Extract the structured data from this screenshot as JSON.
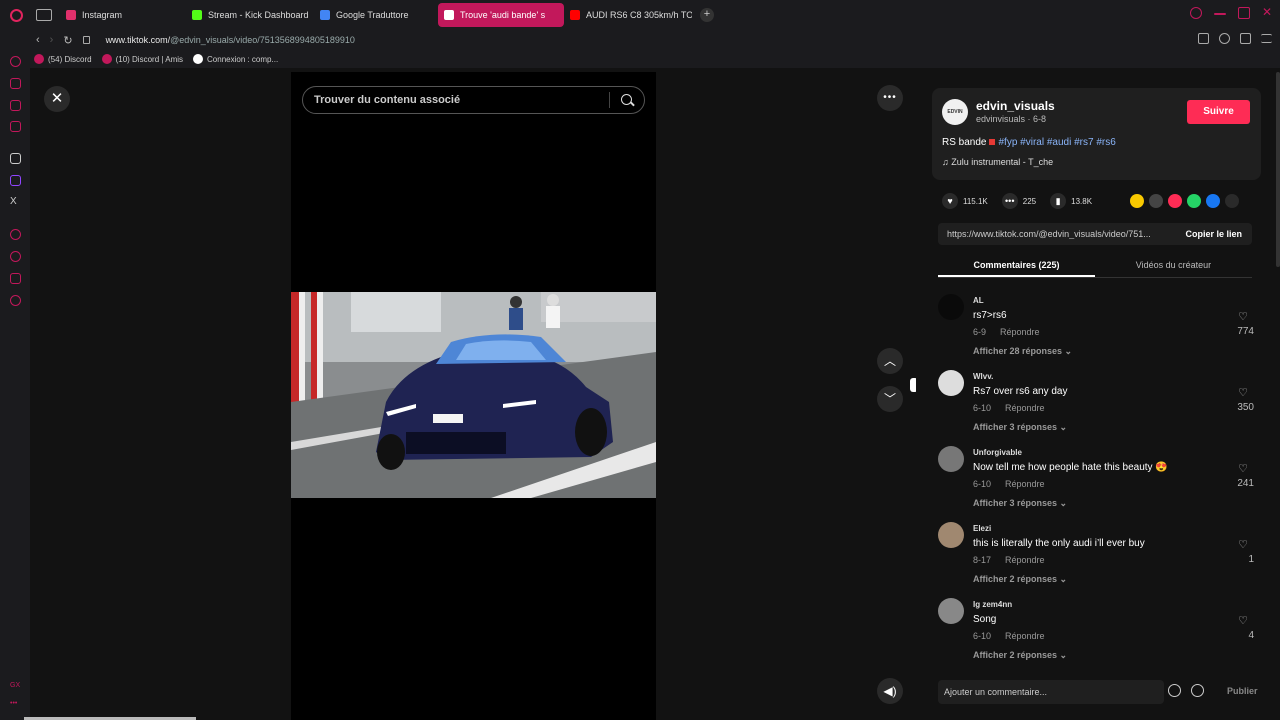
{
  "tabs": [
    {
      "label": "Instagram",
      "color": "#e1306c"
    },
    {
      "label": "Stream - Kick Dashboard",
      "color": "#53fc18"
    },
    {
      "label": "Google Traduttore",
      "color": "#4285f4"
    },
    {
      "label": "Trouve 'audi bande' s",
      "color": "#ffffff",
      "active": true
    },
    {
      "label": "AUDI RS6 C8 305km/h TO",
      "color": "#ff0000"
    }
  ],
  "address": {
    "prefix": "www.tiktok.com/",
    "path": "@edvin_visuals/video/7513568994805189910"
  },
  "bookmarks": [
    {
      "label": "(54) Discord",
      "color": "#c2185b"
    },
    {
      "label": "(10) Discord | Amis",
      "color": "#c2185b"
    },
    {
      "label": "Connexion : comp...",
      "color": "#ffffff"
    }
  ],
  "sidebar": {
    "bottom_label": "GX"
  },
  "search": {
    "placeholder": "Trouver du contenu associé"
  },
  "player": {
    "close_icon": "close-icon",
    "more_icon": "more-icon",
    "up_icon": "chevron-up-icon",
    "down_icon": "chevron-down-icon",
    "volume_icon": "volume-icon"
  },
  "creator": {
    "avatar_text": "EDVIN",
    "username": "edvin_visuals",
    "handle_date": "edvinvisuals · 6-8",
    "follow_label": "Suivre"
  },
  "description": {
    "text": "RS bande",
    "tags": "#fyp #viral #audi #rs7 #rs6"
  },
  "music": {
    "title": "Zulu instrumental - T_che"
  },
  "stats": {
    "likes": "115.1K",
    "comments": "225",
    "saves": "13.8K"
  },
  "share_colors": [
    "#f9c900",
    "#444444",
    "#fe2c55",
    "#25d366",
    "#1877f2",
    "#2a2a2a"
  ],
  "link": {
    "url": "https://www.tiktok.com/@edvin_visuals/video/751...",
    "copy_label": "Copier le lien"
  },
  "panel_tabs": [
    {
      "label": "Commentaires (225)",
      "active": true
    },
    {
      "label": "Vidéos du créateur",
      "active": false
    }
  ],
  "comments": [
    {
      "name": "AL",
      "text": "rs7>rs6",
      "date": "6-9",
      "reply": "Répondre",
      "more": "Afficher 28 réponses",
      "likes": "774",
      "avatar_color": "#0a0a0a"
    },
    {
      "name": "Wlvv.",
      "text": "Rs7 over rs6 any day",
      "date": "6-10",
      "reply": "Répondre",
      "more": "Afficher 3 réponses",
      "likes": "350",
      "avatar_color": "#dddddd"
    },
    {
      "name": "Unforgivable",
      "text": "Now tell me how people hate this beauty 😍",
      "date": "6-10",
      "reply": "Répondre",
      "more": "Afficher 3 réponses",
      "likes": "241",
      "avatar_color": "#777777"
    },
    {
      "name": "Elezi",
      "text": "this is literally the only audi i’ll ever buy",
      "date": "8-17",
      "reply": "Répondre",
      "more": "Afficher 2 réponses",
      "likes": "1",
      "avatar_color": "#a08870"
    },
    {
      "name": "Ig zem4nn",
      "text": "Song",
      "date": "6-10",
      "reply": "Répondre",
      "more": "Afficher 2 réponses",
      "likes": "4",
      "avatar_color": "#888888"
    }
  ],
  "add_comment": {
    "placeholder": "Ajouter un commentaire...",
    "publish_label": "Publier"
  }
}
